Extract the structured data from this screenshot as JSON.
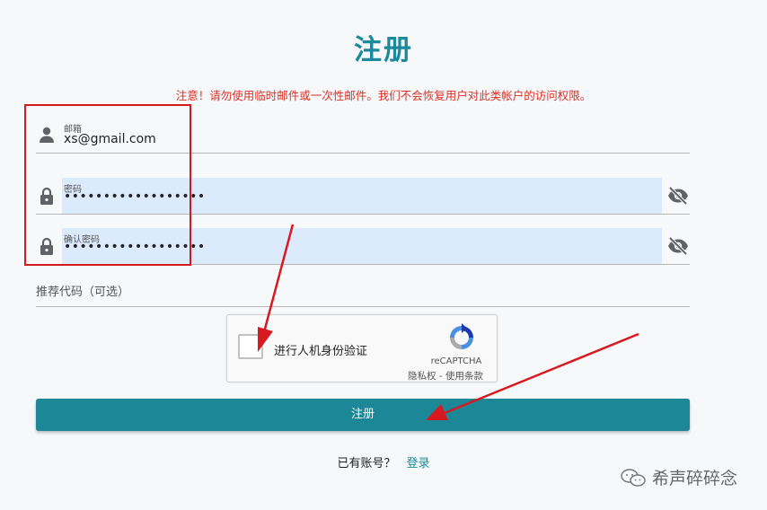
{
  "page": {
    "title": "注册"
  },
  "warning": "注意！请勿使用临时邮件或一次性邮件。我们不会恢复用户对此类帐户的访问权限。",
  "form": {
    "email": {
      "label": "邮箱",
      "value": "xs@gmail.com",
      "icon": "person-icon"
    },
    "password": {
      "label": "密码",
      "value": "••••••••••••••••••",
      "icon": "lock-icon",
      "toggle_icon": "eye-off-icon"
    },
    "confirm_password": {
      "label": "确认密码",
      "value": "••••••••••••••••••",
      "icon": "lock-icon",
      "toggle_icon": "eye-off-icon"
    },
    "referral": {
      "placeholder": "推荐代码（可选）"
    }
  },
  "captcha": {
    "label": "进行人机身份验证",
    "brand": "reCAPTCHA",
    "privacy": "隐私权",
    "separator": " - ",
    "terms": "使用条款",
    "checked": false
  },
  "submit_label": "注册",
  "login": {
    "question": "已有账号？",
    "link": "登录"
  },
  "watermark": {
    "text": "希声碎碎念"
  },
  "colors": {
    "accent": "#1b8797",
    "warning": "#d93025",
    "annotation": "#d71920",
    "autofill": "#dbeafd"
  }
}
